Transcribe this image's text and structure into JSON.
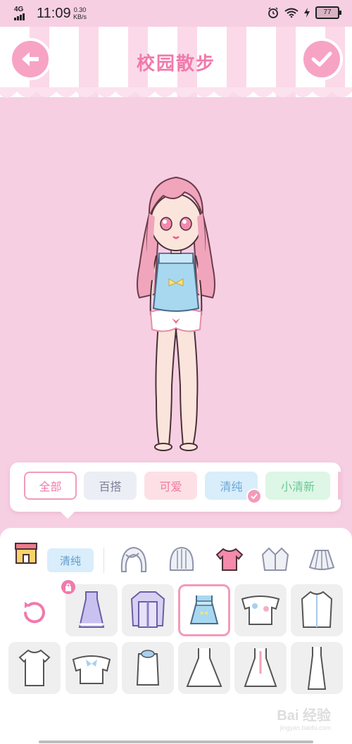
{
  "status_bar": {
    "network": "4G",
    "time": "11:09",
    "speed_value": "0.30",
    "speed_unit": "KB/s",
    "battery": "77"
  },
  "header": {
    "title": "校园散步",
    "back_icon": "arrow-left-icon",
    "confirm_icon": "check-icon"
  },
  "style_filters": [
    {
      "label": "全部",
      "state": "selected-outline"
    },
    {
      "label": "百搭"
    },
    {
      "label": "可爱"
    },
    {
      "label": "清纯",
      "checked": true
    },
    {
      "label": "小清新"
    }
  ],
  "category_bar": {
    "shop_icon": "shop-icon",
    "active_tag": "清纯",
    "categories": [
      "hair-front-icon",
      "hair-back-icon",
      "top-icon",
      "jacket-icon",
      "skirt-icon"
    ],
    "active_category": "top-icon"
  },
  "items": {
    "row1": [
      "reset-icon",
      "lavender-dress",
      "purple-blouse",
      "blue-camisole",
      "floral-top",
      "white-shirt"
    ],
    "row2": [
      "white-tee",
      "bow-blouse",
      "white-sweater",
      "white-dress",
      "pink-ribbon-dress",
      "long-white-dress"
    ],
    "locked": [
      "lavender-dress"
    ],
    "selected": "blue-camisole"
  },
  "watermark": {
    "text": "Bai 经验",
    "sub": "jingyan.baidu.com"
  },
  "colors": {
    "background": "#f7cfe3",
    "accent_pink": "#f07aac",
    "button_pink": "#f7a3c4",
    "camisole_blue": "#a8d8f0"
  }
}
